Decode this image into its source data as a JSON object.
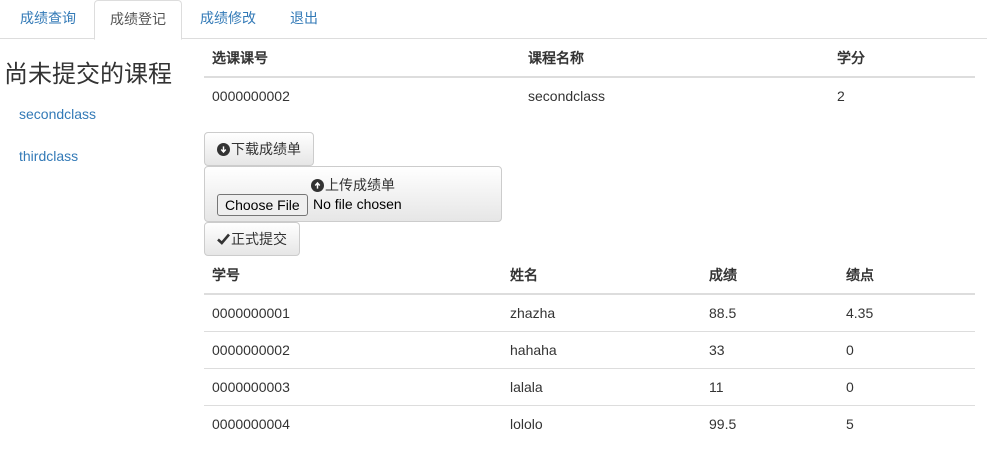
{
  "tabs": [
    {
      "label": "成绩查询"
    },
    {
      "label": "成绩登记"
    },
    {
      "label": "成绩修改"
    },
    {
      "label": "退出"
    }
  ],
  "sidebar": {
    "title": "尚未提交的课程",
    "items": [
      {
        "label": "secondclass"
      },
      {
        "label": "thirdclass"
      }
    ]
  },
  "course_table": {
    "headers": [
      "选课课号",
      "课程名称",
      "学分"
    ],
    "rows": [
      [
        "0000000002",
        "secondclass",
        "2"
      ]
    ]
  },
  "actions": {
    "download_label": "下载成绩单",
    "upload_label": "上传成绩单",
    "choose_file_label": "Choose File",
    "file_status": "No file chosen",
    "submit_label": "正式提交"
  },
  "grade_table": {
    "headers": [
      "学号",
      "姓名",
      "成绩",
      "绩点"
    ],
    "rows": [
      [
        "0000000001",
        "zhazha",
        "88.5",
        "4.35"
      ],
      [
        "0000000002",
        "hahaha",
        "33",
        "0"
      ],
      [
        "0000000003",
        "lalala",
        "11",
        "0"
      ],
      [
        "0000000004",
        "lololo",
        "99.5",
        "5"
      ]
    ]
  },
  "icons": {
    "download": "circle-arrow-down-icon",
    "upload": "circle-arrow-up-icon",
    "submit": "checkmark-icon"
  },
  "colors": {
    "link": "#337ab7",
    "border": "#dddddd",
    "text": "#333333"
  }
}
